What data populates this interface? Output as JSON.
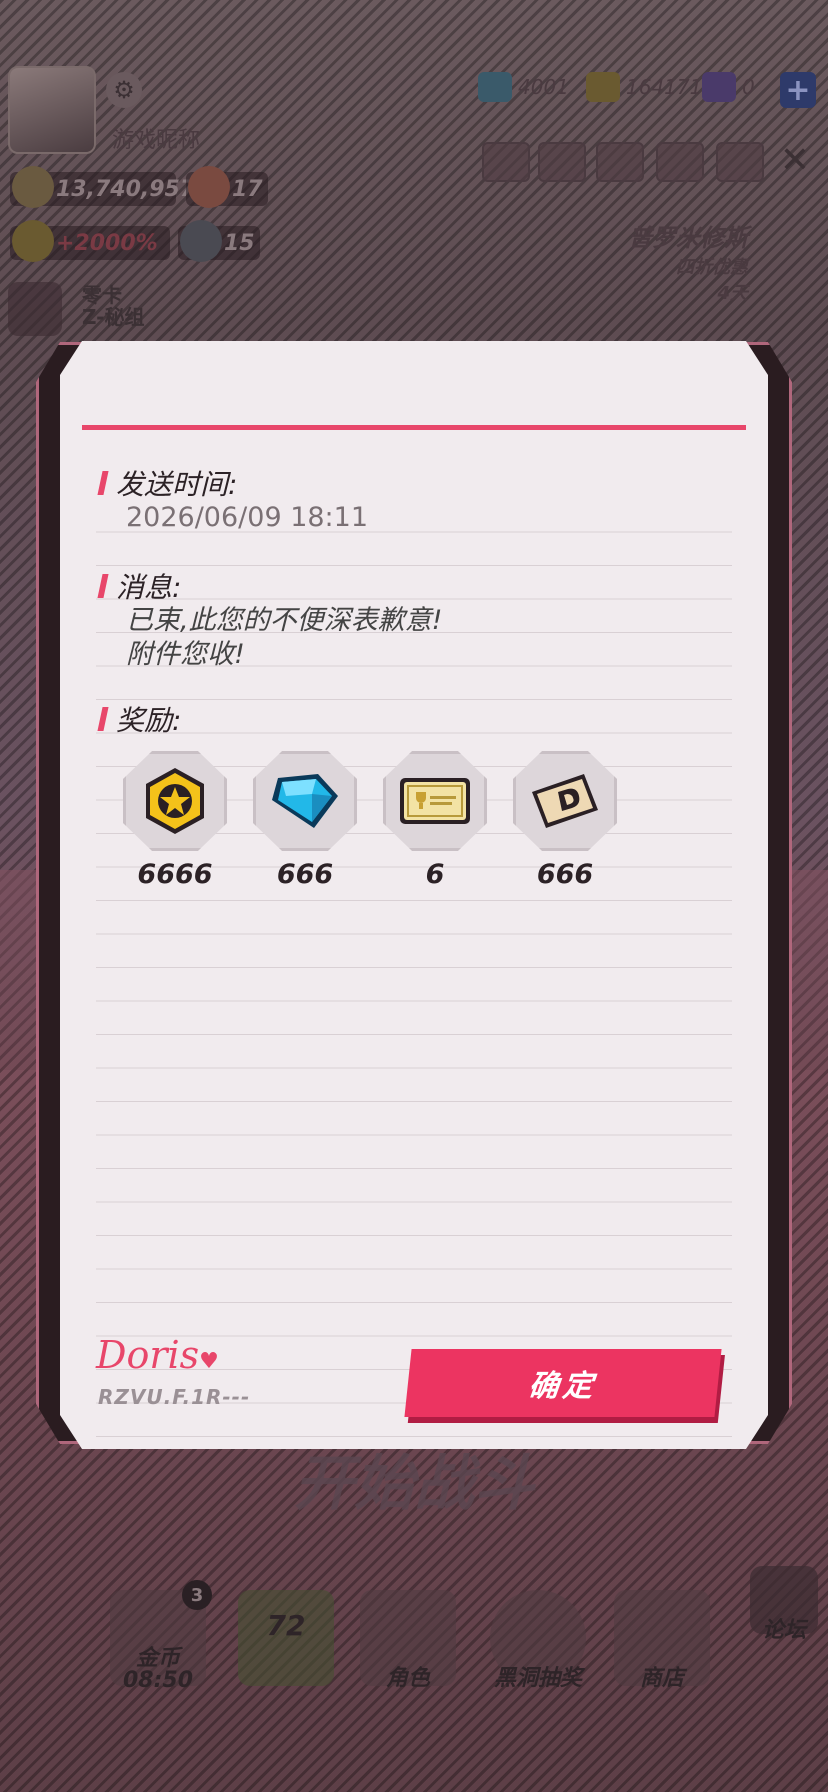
{
  "background": {
    "player_name": "游戏昵称",
    "stats": {
      "power": "13,740,957",
      "hearts": "17",
      "bonus": "+2000%",
      "sword": "15",
      "card_title": "零卡",
      "card_sub": "Z-秘组"
    },
    "currencies": [
      {
        "name": "diamond",
        "value": "4001"
      },
      {
        "name": "coin",
        "value": "164171"
      },
      {
        "name": "gem",
        "value": "0"
      }
    ],
    "event": {
      "title": "普罗米修斯",
      "subtitle": "四折优惠",
      "days": "4天"
    },
    "start_label": "开始战斗",
    "bottom_nav": [
      {
        "label": "金币\n08:50",
        "badge": "3"
      },
      {
        "label": "72",
        "badge": ""
      },
      {
        "label": "角色",
        "badge": ""
      },
      {
        "label": "黑洞抽奖",
        "badge": ""
      },
      {
        "label": "商店",
        "badge": ""
      }
    ],
    "forum_label": "论坛"
  },
  "mail": {
    "send_time_label": "发送时间:",
    "send_time": "2026/06/09 18:11",
    "message_label": "消息:",
    "message_line1": "已束,此您的不便深表歉意!",
    "message_line2": "附件您收!",
    "rewards_label": "奖励:",
    "rewards": [
      {
        "icon": "gold-coin-icon",
        "count": "6666"
      },
      {
        "icon": "blue-diamond-icon",
        "count": "666"
      },
      {
        "icon": "ticket-icon",
        "count": "6"
      },
      {
        "icon": "d-card-icon",
        "count": "666"
      }
    ],
    "signature": "Doris",
    "signature_code": "RZVU.F.1R---",
    "confirm_label": "确定"
  },
  "colors": {
    "accent": "#e8466a",
    "button": "#ec3461",
    "dialog_bg": "#f1ebee"
  }
}
